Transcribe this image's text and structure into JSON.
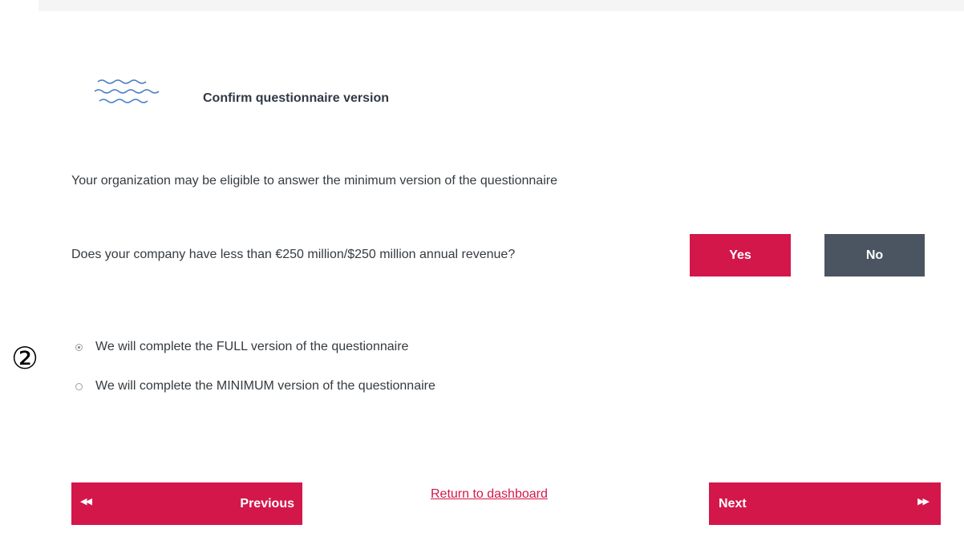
{
  "step_marker": "②",
  "header": {
    "icon": "waves-icon",
    "title": "Confirm questionnaire version"
  },
  "eligibility_text": "Your organization may be eligible to answer the minimum version of the questionnaire",
  "revenue_question": {
    "text": "Does your company have less than €250 million/$250 million annual revenue?",
    "yes_label": "Yes",
    "no_label": "No"
  },
  "options": {
    "full": {
      "label": "We will complete the FULL version of the questionnaire",
      "selected": true
    },
    "minimum": {
      "label": "We will complete the MINIMUM version of the questionnaire",
      "selected": false
    }
  },
  "navigation": {
    "previous_label": "Previous",
    "previous_icon": "double-arrow-left-icon",
    "return_label": "Return to dashboard",
    "next_label": "Next",
    "next_icon": "double-arrow-right-icon"
  },
  "colors": {
    "accent": "#d3174a",
    "secondary_button": "#4b5561",
    "text": "#353b40",
    "icon": "#4a7fc1"
  }
}
